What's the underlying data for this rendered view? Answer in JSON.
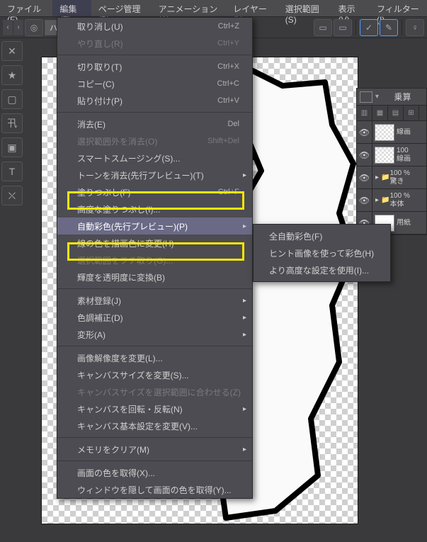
{
  "menubar": {
    "items": [
      {
        "label": "ファイル(F)"
      },
      {
        "label": "編集(E)"
      },
      {
        "label": "ページ管理(P)"
      },
      {
        "label": "アニメーション(A)"
      },
      {
        "label": "レイヤー(L)"
      },
      {
        "label": "選択範囲(S)"
      },
      {
        "label": "表示(V)"
      },
      {
        "label": "フィルター(I)"
      }
    ],
    "active_index": 1
  },
  "toolbar": {
    "dropdown_label": "ハシケン"
  },
  "edit_menu": {
    "groups": [
      [
        {
          "label": "取り消し(U)",
          "shortcut": "Ctrl+Z"
        },
        {
          "label": "やり直し(R)",
          "shortcut": "Ctrl+Y",
          "disabled": true
        }
      ],
      [
        {
          "label": "切り取り(T)",
          "shortcut": "Ctrl+X"
        },
        {
          "label": "コピー(C)",
          "shortcut": "Ctrl+C"
        },
        {
          "label": "貼り付け(P)",
          "shortcut": "Ctrl+V"
        }
      ],
      [
        {
          "label": "消去(E)",
          "shortcut": "Del"
        },
        {
          "label": "選択範囲外を消去(O)",
          "shortcut": "Shift+Del",
          "disabled": true
        },
        {
          "label": "スマートスムージング(S)..."
        },
        {
          "label": "トーンを消去(先行プレビュー)(T)",
          "submenu": true,
          "highlight": true
        },
        {
          "label": "塗りつぶし(F)",
          "shortcut": "Ctrl+F"
        },
        {
          "label": "高度な塗りつぶし(I)..."
        },
        {
          "label": "自動彩色(先行プレビュー)(P)",
          "submenu": true,
          "highlight": true,
          "hover": true
        },
        {
          "label": "線の色を描画色に変更(H)"
        },
        {
          "label": "選択範囲をフチ取り(G)...",
          "disabled": true
        },
        {
          "label": "輝度を透明度に変換(B)"
        }
      ],
      [
        {
          "label": "素材登録(J)",
          "submenu": true
        },
        {
          "label": "色調補正(D)",
          "submenu": true
        },
        {
          "label": "変形(A)",
          "submenu": true
        }
      ],
      [
        {
          "label": "画像解像度を変更(L)..."
        },
        {
          "label": "キャンバスサイズを変更(S)..."
        },
        {
          "label": "キャンバスサイズを選択範囲に合わせる(Z)",
          "disabled": true
        },
        {
          "label": "キャンバスを回転・反転(N)",
          "submenu": true
        },
        {
          "label": "キャンバス基本設定を変更(V)..."
        }
      ],
      [
        {
          "label": "メモリをクリア(M)",
          "submenu": true
        }
      ],
      [
        {
          "label": "画面の色を取得(X)..."
        },
        {
          "label": "ウィンドウを隠して画面の色を取得(Y)..."
        }
      ]
    ]
  },
  "auto_color_submenu": {
    "items": [
      {
        "label": "全自動彩色(F)"
      },
      {
        "label": "ヒント画像を使って彩色(H)"
      },
      {
        "label": "より高度な設定を使用(I)..."
      }
    ]
  },
  "layers_panel": {
    "blend_mode": "乗算",
    "rows": [
      {
        "opacity": "驚き",
        "name": ""
      },
      {
        "opacity": "",
        "name": "線画"
      },
      {
        "opacity": "100",
        "name": "線画"
      },
      {
        "opacity": "100 %",
        "name": "驚き"
      },
      {
        "opacity": "100 %",
        "name": "本体",
        "folder": true
      },
      {
        "opacity": "",
        "name": "用紙",
        "paper": true
      }
    ]
  }
}
